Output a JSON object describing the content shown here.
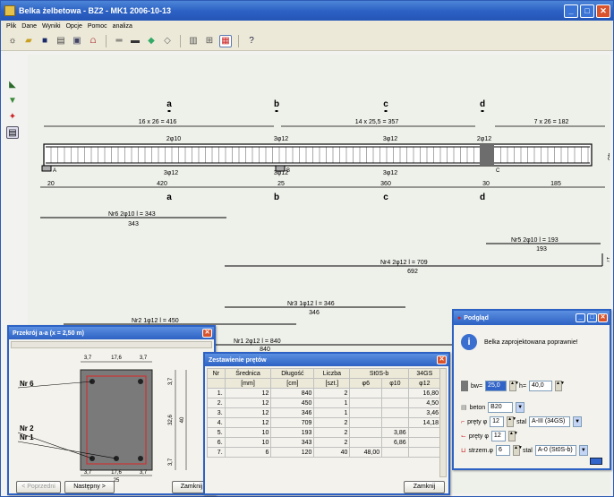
{
  "window": {
    "title": "Belka żelbetowa - BZ2 - MK1 2006-10-13"
  },
  "menu": [
    "Plik",
    "Dane",
    "Wyniki",
    "Opcje",
    "Pomoc",
    "analiza"
  ],
  "toolbar_icons": [
    "sun-icon",
    "folder-icon",
    "save-icon",
    "print-icon",
    "export-icon",
    "figure-icon",
    "beam-icon",
    "section-icon",
    "paint-icon",
    "eraser-icon",
    "clipboard-icon",
    "grid-icon",
    "calc-icon",
    "help-icon"
  ],
  "lefttools": [
    "select-icon",
    "arrows-icon",
    "down-icon",
    "dialog-icon"
  ],
  "beam": {
    "supports": [
      "a",
      "b",
      "c",
      "d"
    ],
    "sections": [
      "a",
      "b",
      "c",
      "d"
    ],
    "stirrups": [
      "16 x 26 = 416",
      "14 x 25,5 = 357",
      "7 x 26 = 182"
    ],
    "top_bars": [
      "2φ10",
      "3φ12",
      "3φ12",
      "2φ12"
    ],
    "bottom_bars": [
      "3φ12",
      "3φ12",
      "3φ12"
    ],
    "node_labels": [
      "A",
      "B",
      "C"
    ],
    "dims": [
      "20",
      "420",
      "25",
      "360",
      "30",
      "185"
    ],
    "height": "40",
    "bars": [
      {
        "label": "Nr6  2φ10  l = 343",
        "len": "343"
      },
      {
        "label": "Nr5  2φ10  l = 193",
        "len": "193"
      },
      {
        "label": "Nr4  2φ12  l = 709",
        "len": "692",
        "hook": "17"
      },
      {
        "label": "Nr3  1φ12  l = 346",
        "len": "346"
      },
      {
        "label": "Nr2  1φ12  l = 450"
      },
      {
        "label": "Nr1  2φ12  l = 840",
        "len": "840"
      }
    ]
  },
  "section_dlg": {
    "title": "Przekrój a-a  (x = 2,50 m)",
    "top_dims": [
      "3,7",
      "17,6",
      "3,7"
    ],
    "bot_dims": [
      "3,7",
      "17,6",
      "3,7"
    ],
    "width": "25",
    "side_dims": [
      "3,7",
      "32,6",
      "3,7"
    ],
    "height": "40",
    "bars": [
      "Nr 6",
      "Nr 2",
      "Nr 1"
    ],
    "prev": "< Poprzedni",
    "next": "Następny >",
    "close": "Zamknij"
  },
  "steel_dlg": {
    "title": "Zestawienie prętów",
    "h1": [
      "Nr",
      "Średnica",
      "Długość",
      "Liczba",
      "St0S-b",
      "34GS"
    ],
    "h2": [
      "",
      "[mm]",
      "[cm]",
      "[szt.]",
      "φ6",
      "φ10",
      "φ12"
    ],
    "rows": [
      [
        "1.",
        "12",
        "840",
        "2",
        "",
        "",
        "16,80"
      ],
      [
        "2.",
        "12",
        "450",
        "1",
        "",
        "",
        "4,50"
      ],
      [
        "3.",
        "12",
        "346",
        "1",
        "",
        "",
        "3,46"
      ],
      [
        "4.",
        "12",
        "709",
        "2",
        "",
        "",
        "14,18"
      ],
      [
        "5.",
        "10",
        "193",
        "2",
        "",
        "3,86",
        ""
      ],
      [
        "6.",
        "10",
        "343",
        "2",
        "",
        "6,86",
        ""
      ],
      [
        "7.",
        "6",
        "120",
        "40",
        "48,00",
        "",
        ""
      ]
    ],
    "close": "Zamknij"
  },
  "preview_dlg": {
    "title": "Podgląd",
    "msg": "Belka zaprojektowana poprawnie!",
    "bw_label": "bw=",
    "bw": "25,0",
    "h_label": "h=",
    "h": "40,0",
    "beton_label": "beton",
    "beton": "B20",
    "pret1_label": "pręty φ",
    "pret1": "12",
    "pret2_label": "pręty φ",
    "pret2": "12",
    "strzem_label": "strzem.φ",
    "strzem": "6",
    "stal_label": "stal",
    "stal1": "A-III (34GS)",
    "stal2": "A-0 (St0S-b)"
  }
}
